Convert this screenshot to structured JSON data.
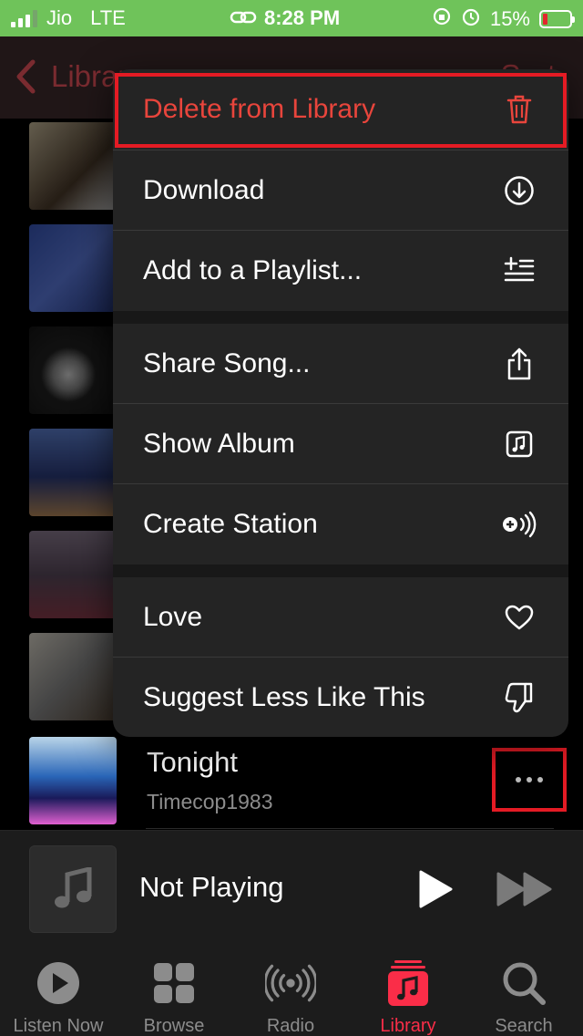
{
  "status_bar": {
    "carrier": "Jio",
    "network": "LTE",
    "time": "8:28 PM",
    "battery": "15%"
  },
  "nav": {
    "back_label": "Library",
    "right_label": "Sort"
  },
  "menu": {
    "items": [
      {
        "label": "Delete from Library",
        "icon": "trash-icon"
      },
      {
        "label": "Download",
        "icon": "download-icon"
      },
      {
        "label": "Add to a Playlist...",
        "icon": "add-to-playlist-icon"
      },
      {
        "label": "Share Song...",
        "icon": "share-icon"
      },
      {
        "label": "Show Album",
        "icon": "album-icon"
      },
      {
        "label": "Create Station",
        "icon": "station-icon"
      },
      {
        "label": "Love",
        "icon": "heart-icon"
      },
      {
        "label": "Suggest Less Like This",
        "icon": "thumbs-down-icon"
      }
    ]
  },
  "song": {
    "title": "Tonight",
    "artist": "Timecop1983"
  },
  "mini_player": {
    "title": "Not Playing"
  },
  "tabs": [
    {
      "label": "Listen Now",
      "icon": "play-circle-icon"
    },
    {
      "label": "Browse",
      "icon": "grid-icon"
    },
    {
      "label": "Radio",
      "icon": "radio-icon"
    },
    {
      "label": "Library",
      "icon": "library-icon",
      "active": true
    },
    {
      "label": "Search",
      "icon": "search-icon"
    }
  ],
  "colors": {
    "accent": "#fa2d48",
    "delete": "#e8453c",
    "highlight": "#e41b24",
    "status_bar": "#6fc35a"
  }
}
